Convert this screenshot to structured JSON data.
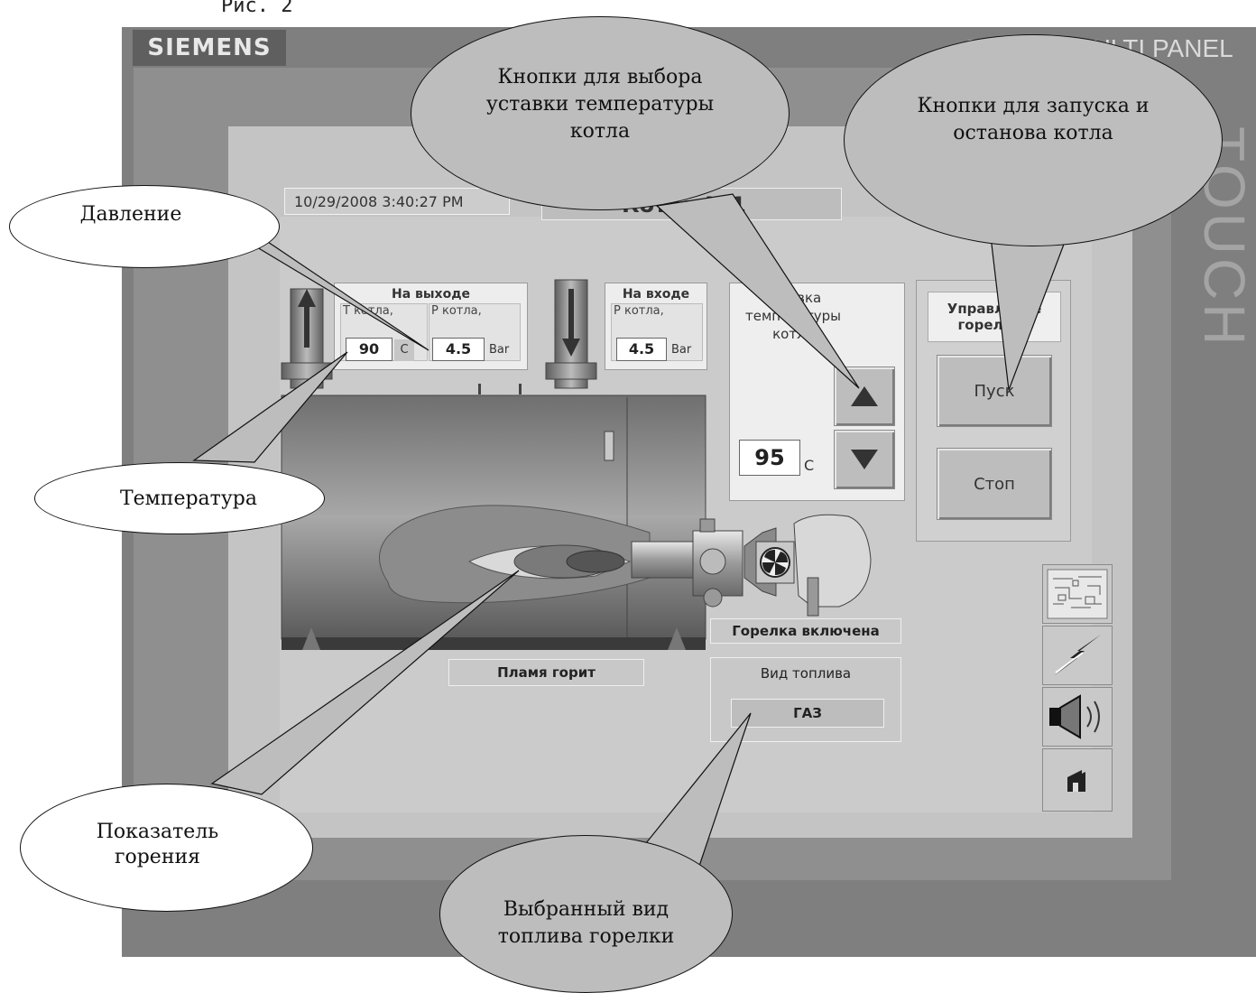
{
  "caption": "Рис. 2",
  "panel": {
    "brand": "SIEMENS",
    "model": "SIMATIC MULTI PANEL",
    "side_label": "TOUCH"
  },
  "header": {
    "datetime": "10/29/2008 3:40:27 PM",
    "title": "Котёл №1"
  },
  "outlet": {
    "title": "На выходе",
    "temp_label": "T котла,",
    "temp_value": "90",
    "temp_unit": "C",
    "pressure_label": "P котла,",
    "pressure_value": "4.5",
    "pressure_unit": "Bar"
  },
  "inlet": {
    "title": "На входе",
    "pressure_label": "P котла,",
    "pressure_value": "4.5",
    "pressure_unit": "Bar"
  },
  "setpoint": {
    "title": "Уставка температуры котла",
    "value": "95",
    "unit": "C"
  },
  "burner_control": {
    "title": "Управление горелкой",
    "start_label": "Пуск",
    "stop_label": "Стоп"
  },
  "status": {
    "flame": "Пламя горит",
    "burner": "Горелка включена"
  },
  "fuel": {
    "title": "Вид топлива",
    "value": "ГАЗ"
  },
  "callouts": {
    "pressure": "Давление",
    "temperature": "Температура",
    "setpoint_buttons": "Кнопки для выбора уставки температуры котла",
    "start_stop_buttons": "Кнопки для запуска и останова котла",
    "combustion": "Показатель горения",
    "fuel_selected": "Выбранный вид топлива горелки"
  },
  "colors": {
    "bezel": "#7f7f7f",
    "screen": "#c4c4c4",
    "panel_group": "#ededed"
  },
  "icons": [
    "arrow-up-icon",
    "arrow-down-icon",
    "fan-icon",
    "overview-icon",
    "lightning-icon",
    "speaker-icon",
    "home-icon"
  ]
}
